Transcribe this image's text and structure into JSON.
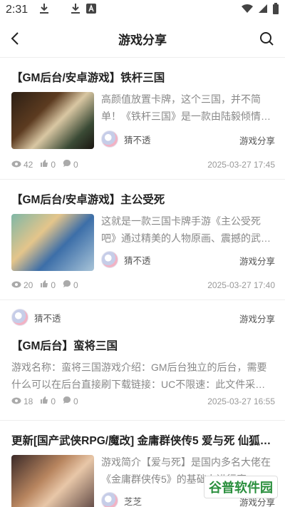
{
  "status_bar": {
    "time": "2:31"
  },
  "nav": {
    "title": "游戏分享"
  },
  "posts": [
    {
      "title": "【GM后台/安卓游戏】铁杆三国",
      "excerpt": "高颜值放置卡牌，这个三国，并不简单！《铁杆三国》是一款由陆毅倾情…",
      "author": "猜不透",
      "category": "游戏分享",
      "views": "42",
      "likes": "0",
      "comments": "0",
      "date": "2025-03-27 17:45"
    },
    {
      "title": "【GM后台/安卓游戏】主公受死",
      "excerpt": "这就是一款三国卡牌手游《主公受死吧》通过精美的人物原画、震撼的武…",
      "author": "猜不透",
      "category": "游戏分享",
      "views": "20",
      "likes": "0",
      "comments": "0",
      "date": "2025-03-27 17:40"
    },
    {
      "title": "【GM后台】蛮将三国",
      "excerpt": "游戏名称：蛮将三国游戏介绍：GM后台独立的后台，需要什么可以在后台直接刷下载链接：UC不限速：此文件采…",
      "author": "猜不透",
      "category": "游戏分享",
      "views": "18",
      "likes": "0",
      "comments": "0",
      "date": "2025-03-27 16:55"
    },
    {
      "title": "更新[国产武侠RPG/魔改] 金庸群侠传5 爱与死 仙狐…",
      "excerpt": "游戏简介【爱与死】是国内多名大佬在《金庸群侠传5》的基础上进行魔…",
      "author": "芝芝",
      "category": "游戏分享"
    }
  ],
  "watermark": "谷普软件园"
}
